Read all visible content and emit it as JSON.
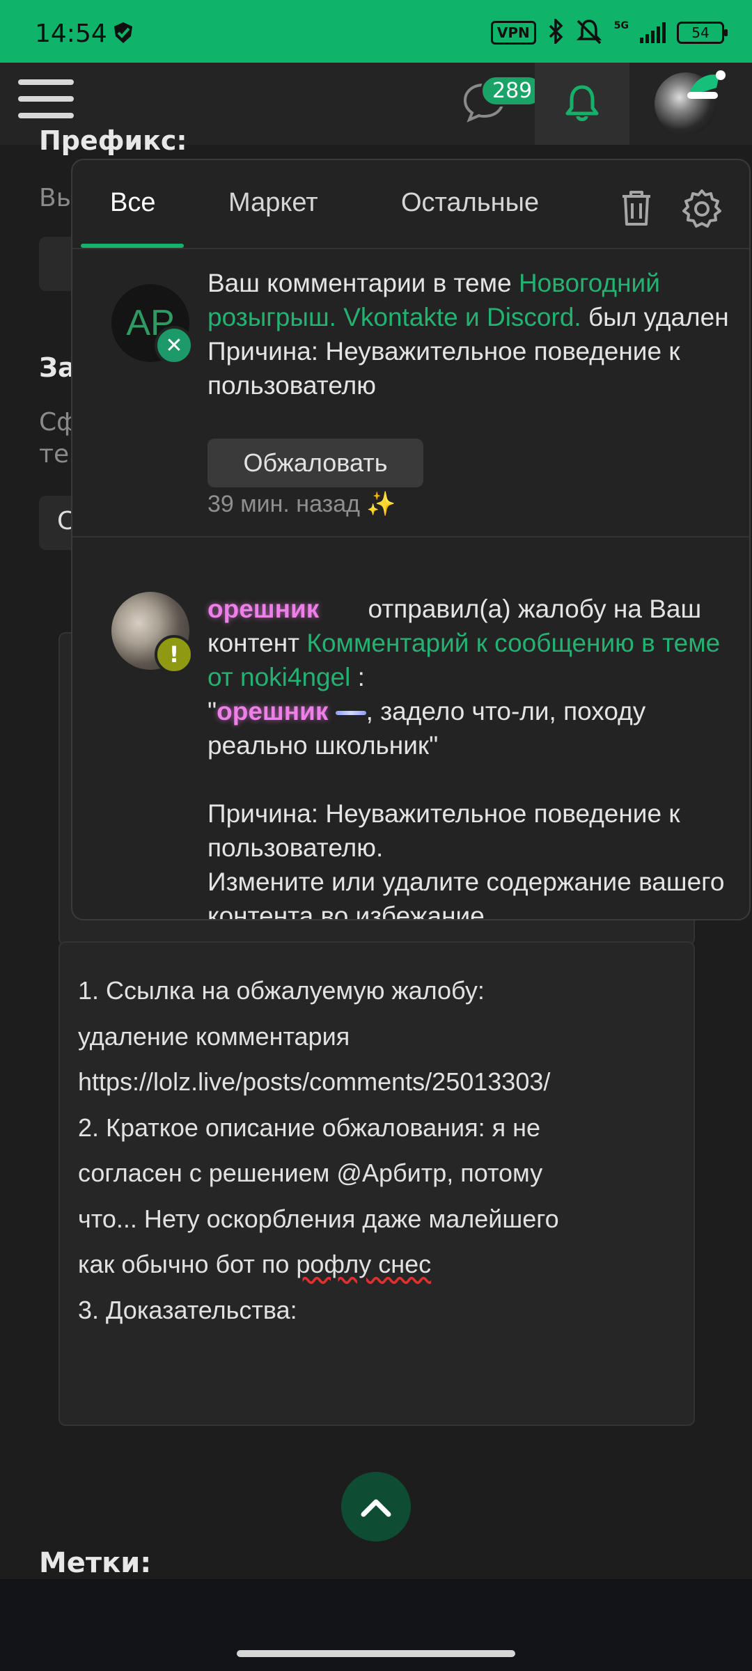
{
  "status_bar": {
    "time": "14:54",
    "vpn": "VPN",
    "network": "5G",
    "battery": "54",
    "bg_color": "#0fb36a"
  },
  "top_nav": {
    "chat_count": "289",
    "icons": [
      "menu-icon",
      "chat-bubble-icon",
      "bell-icon",
      "user-avatar"
    ]
  },
  "background_page": {
    "prefix_label": "Префикс:",
    "prefix_hint": "Вы",
    "section_label": "За",
    "section_hint_1": "Сф",
    "section_hint_2": "те",
    "section_box_letter": "С",
    "tags_label": "Метки:",
    "editor_lines": [
      "1. Ссылка на обжалуемую жалобу:",
      "удаление комментария",
      "https://lolz.live/posts/comments/25013303/",
      "2. Краткое описание обжалования: я не",
      "согласен с решением @Арбитр, потому",
      "что... Нету оскорбления даже малейшего",
      "как обычно бот по ",
      "рофлу снес",
      "3. Доказательства:"
    ]
  },
  "notifications_popup": {
    "tabs": [
      {
        "label": "Все",
        "active": true
      },
      {
        "label": "Маркет",
        "active": false
      },
      {
        "label": "Остальные",
        "active": false
      }
    ],
    "notifications": [
      {
        "avatar_initials": "AP",
        "text_before_link": "Ваш комментарии в теме ",
        "link_text": "Новогодний розыгрыш. Vkontakte и Discord.",
        "text_after_link": " был удален Причина: Неуважительное поведение к пользователю",
        "action_button": "Обжаловать",
        "time_ago": "39 мин. назад",
        "time_icon": "✨"
      },
      {
        "username": "орешник",
        "text_1": " отправил(а) жалобу на Ваш контент ",
        "link_text": "Комментарий к сообщению в теме от noki4ngel",
        "text_2": " :",
        "quote_open": "\"",
        "quote_username": "орешник",
        "quote_text": ", задело что-ли, походу реально школьник\"",
        "reason": "Причина: Неуважительное поведение к пользователю.",
        "advice": "Измените или удалите содержание вашего контента во избежание"
      }
    ]
  },
  "colors": {
    "accent": "#16b06a",
    "link": "#23b272",
    "username": "#ee7fe8",
    "background": "#1d1d1d"
  }
}
